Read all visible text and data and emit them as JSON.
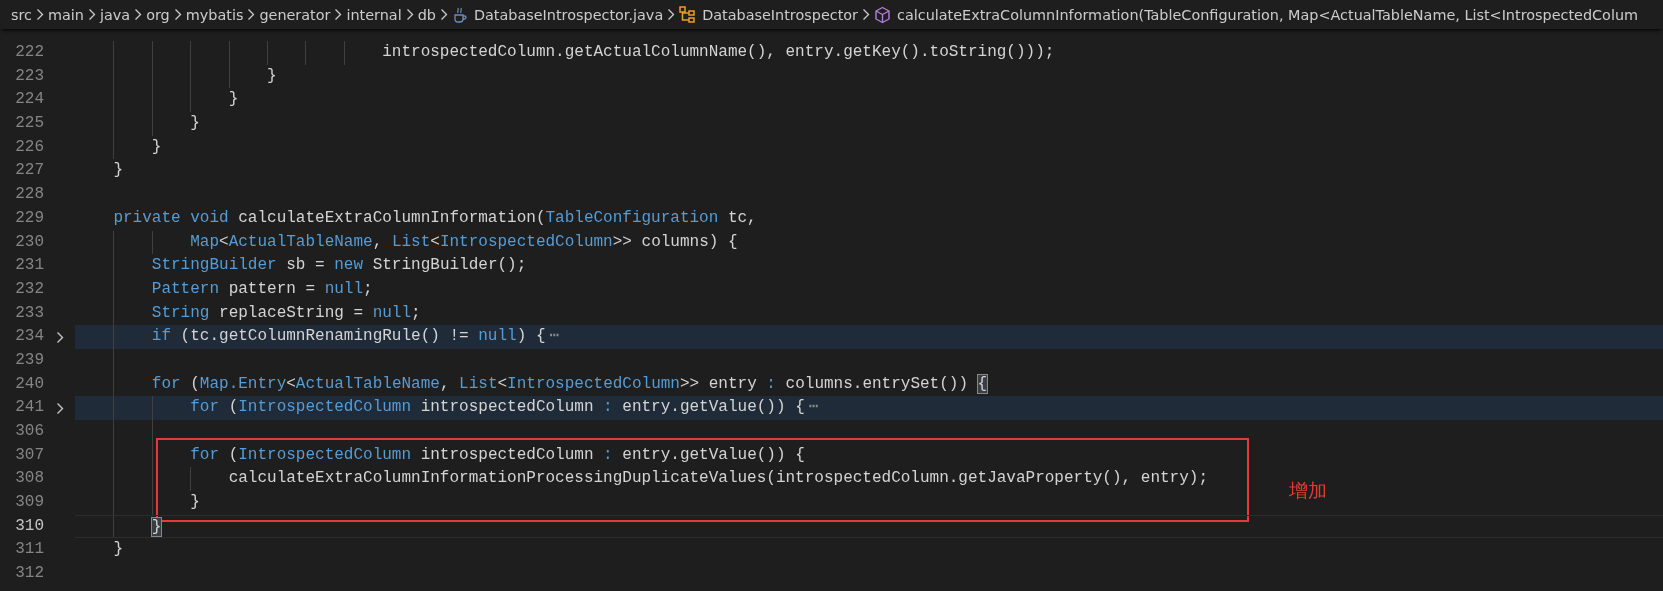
{
  "breadcrumb": [
    {
      "kind": "folder",
      "label": "src"
    },
    {
      "kind": "folder",
      "label": "main"
    },
    {
      "kind": "folder",
      "label": "java"
    },
    {
      "kind": "folder",
      "label": "org"
    },
    {
      "kind": "folder",
      "label": "mybatis"
    },
    {
      "kind": "folder",
      "label": "generator"
    },
    {
      "kind": "folder",
      "label": "internal"
    },
    {
      "kind": "folder",
      "label": "db"
    },
    {
      "kind": "file",
      "label": "DatabaseIntrospector.java"
    },
    {
      "kind": "class",
      "label": "DatabaseIntrospector"
    },
    {
      "kind": "method",
      "label": "calculateExtraColumnInformation(TableConfiguration, Map<ActualTableName, List<IntrospectedColum"
    }
  ],
  "editor": {
    "annotation": {
      "label": "增加"
    },
    "lines": [
      {
        "number": "222",
        "folded": false,
        "current": false,
        "boxed": false,
        "tokens": [
          {
            "kind": "plain",
            "text": "                                introspectedColumn.getActualColumnName(), entry.getKey().toString()));"
          }
        ]
      },
      {
        "number": "223",
        "folded": false,
        "current": false,
        "boxed": false,
        "tokens": [
          {
            "kind": "plain",
            "text": "                    }"
          }
        ]
      },
      {
        "number": "224",
        "folded": false,
        "current": false,
        "boxed": false,
        "tokens": [
          {
            "kind": "plain",
            "text": "                }"
          }
        ]
      },
      {
        "number": "225",
        "folded": false,
        "current": false,
        "boxed": false,
        "tokens": [
          {
            "kind": "plain",
            "text": "            }"
          }
        ]
      },
      {
        "number": "226",
        "folded": false,
        "current": false,
        "boxed": false,
        "tokens": [
          {
            "kind": "plain",
            "text": "        }"
          }
        ]
      },
      {
        "number": "227",
        "folded": false,
        "current": false,
        "boxed": false,
        "tokens": [
          {
            "kind": "plain",
            "text": "    }"
          }
        ]
      },
      {
        "number": "228",
        "folded": false,
        "current": false,
        "boxed": false
      },
      {
        "number": "229",
        "folded": false,
        "current": false,
        "boxed": false,
        "tokens": [
          {
            "kind": "kw",
            "text": "    private void"
          },
          {
            "kind": "plain",
            "text": " calculateExtraColumnInformation("
          },
          {
            "kind": "kw",
            "text": "TableConfiguration"
          },
          {
            "kind": "plain",
            "text": " tc,"
          }
        ]
      },
      {
        "number": "230",
        "folded": false,
        "current": false,
        "boxed": false,
        "tokens": [
          {
            "kind": "kw",
            "text": "            Map"
          },
          {
            "kind": "plain",
            "text": "<"
          },
          {
            "kind": "kw",
            "text": "ActualTableName"
          },
          {
            "kind": "plain",
            "text": ", "
          },
          {
            "kind": "kw",
            "text": "List"
          },
          {
            "kind": "plain",
            "text": "<"
          },
          {
            "kind": "kw",
            "text": "IntrospectedColumn"
          },
          {
            "kind": "plain",
            "text": ">> columns) {"
          }
        ]
      },
      {
        "number": "231",
        "folded": false,
        "current": false,
        "boxed": false,
        "tokens": [
          {
            "kind": "kw",
            "text": "        StringBuilder"
          },
          {
            "kind": "plain",
            "text": " sb = "
          },
          {
            "kind": "kw",
            "text": "new"
          },
          {
            "kind": "plain",
            "text": " StringBuilder();"
          }
        ]
      },
      {
        "number": "232",
        "folded": false,
        "current": false,
        "boxed": false,
        "tokens": [
          {
            "kind": "kw",
            "text": "        Pattern"
          },
          {
            "kind": "plain",
            "text": " pattern = "
          },
          {
            "kind": "kw",
            "text": "null"
          },
          {
            "kind": "plain",
            "text": ";"
          }
        ]
      },
      {
        "number": "233",
        "folded": false,
        "current": false,
        "boxed": false,
        "tokens": [
          {
            "kind": "kw",
            "text": "        String"
          },
          {
            "kind": "plain",
            "text": " replaceString = "
          },
          {
            "kind": "kw",
            "text": "null"
          },
          {
            "kind": "plain",
            "text": ";"
          }
        ]
      },
      {
        "number": "234",
        "folded": true,
        "current": false,
        "boxed": false,
        "tokens": [
          {
            "kind": "kw",
            "text": "        if"
          },
          {
            "kind": "plain",
            "text": " (tc.getColumnRenamingRule() != "
          },
          {
            "kind": "kw",
            "text": "null"
          },
          {
            "kind": "plain",
            "text": ") {"
          },
          {
            "kind": "fold",
            "text": "⋯"
          }
        ]
      },
      {
        "number": "239",
        "folded": false,
        "current": false,
        "boxed": false
      },
      {
        "number": "240",
        "folded": false,
        "current": false,
        "boxed": false,
        "tokens": [
          {
            "kind": "kw",
            "text": "        for"
          },
          {
            "kind": "plain",
            "text": " ("
          },
          {
            "kind": "kw",
            "text": "Map.Entry"
          },
          {
            "kind": "plain",
            "text": "<"
          },
          {
            "kind": "kw",
            "text": "ActualTableName"
          },
          {
            "kind": "plain",
            "text": ", "
          },
          {
            "kind": "kw",
            "text": "List"
          },
          {
            "kind": "plain",
            "text": "<"
          },
          {
            "kind": "kw",
            "text": "IntrospectedColumn"
          },
          {
            "kind": "plain",
            "text": ">> entry "
          },
          {
            "kind": "kw",
            "text": ":"
          },
          {
            "kind": "plain",
            "text": " columns.entrySet()) "
          },
          {
            "kind": "bracket",
            "text": "{"
          }
        ]
      },
      {
        "number": "241",
        "folded": true,
        "current": false,
        "boxed": false,
        "tokens": [
          {
            "kind": "kw",
            "text": "            for"
          },
          {
            "kind": "plain",
            "text": " ("
          },
          {
            "kind": "kw",
            "text": "IntrospectedColumn"
          },
          {
            "kind": "plain",
            "text": " introspectedColumn "
          },
          {
            "kind": "kw",
            "text": ":"
          },
          {
            "kind": "plain",
            "text": " entry.getValue()) {"
          },
          {
            "kind": "fold",
            "text": "⋯"
          }
        ]
      },
      {
        "number": "306",
        "folded": false,
        "current": false,
        "boxed": false
      },
      {
        "number": "307",
        "folded": false,
        "current": false,
        "boxed": true,
        "tokens": [
          {
            "kind": "kw",
            "text": "            for"
          },
          {
            "kind": "plain",
            "text": " ("
          },
          {
            "kind": "kw",
            "text": "IntrospectedColumn"
          },
          {
            "kind": "plain",
            "text": " introspectedColumn "
          },
          {
            "kind": "kw",
            "text": ":"
          },
          {
            "kind": "plain",
            "text": " entry.getValue()) {"
          }
        ]
      },
      {
        "number": "308",
        "folded": false,
        "current": false,
        "boxed": true,
        "tokens": [
          {
            "kind": "plain",
            "text": "                calculateExtraColumnInformationProcessingDuplicateValues(introspectedColumn.getJavaProperty(), entry);"
          }
        ]
      },
      {
        "number": "309",
        "folded": false,
        "current": false,
        "boxed": true,
        "tokens": [
          {
            "kind": "plain",
            "text": "            }"
          }
        ]
      },
      {
        "number": "310",
        "folded": false,
        "current": true,
        "boxed": false,
        "tokens": [
          {
            "kind": "bracket",
            "text": "        }"
          }
        ]
      },
      {
        "number": "311",
        "folded": false,
        "current": false,
        "boxed": false,
        "tokens": [
          {
            "kind": "plain",
            "text": "    }"
          }
        ]
      },
      {
        "number": "312",
        "folded": false,
        "current": false,
        "boxed": false
      }
    ]
  }
}
